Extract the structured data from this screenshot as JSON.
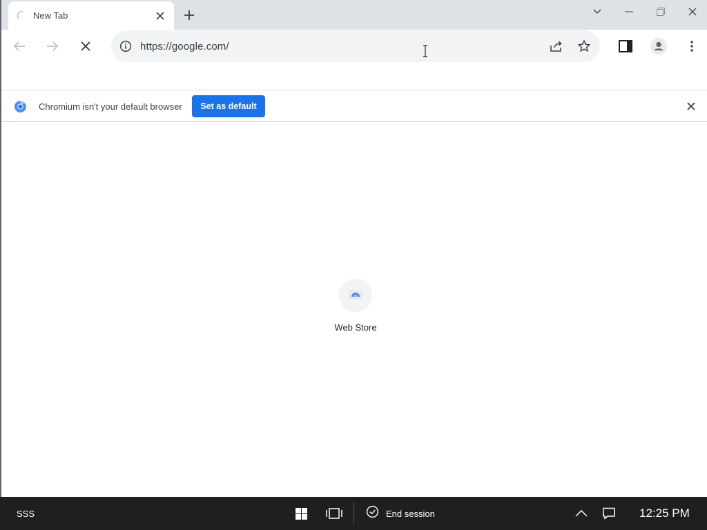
{
  "tab": {
    "title": "New Tab"
  },
  "toolbar": {
    "url": "https://google.com/"
  },
  "infobar": {
    "message": "Chromium isn't your default browser",
    "button_label": "Set as default"
  },
  "content": {
    "shortcuts": [
      {
        "label": "Web Store"
      }
    ]
  },
  "taskbar": {
    "user": "SSS",
    "end_session_label": "End session",
    "clock": "12:25 PM"
  },
  "colors": {
    "accent": "#1a73e8",
    "tabstrip": "#dee1e6",
    "omnibox": "#f1f3f4",
    "taskbar": "#1f1f1f"
  }
}
